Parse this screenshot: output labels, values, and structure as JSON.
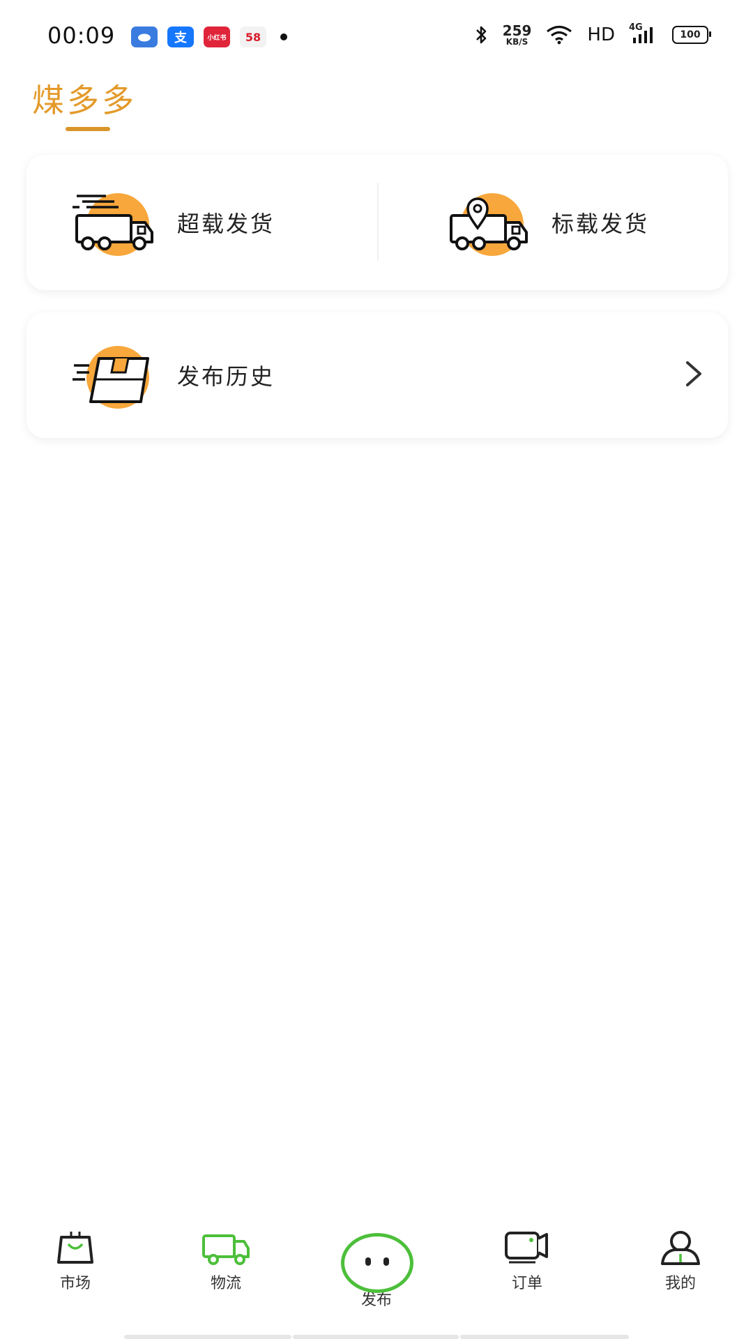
{
  "status_bar": {
    "time": "00:09",
    "apps": [
      {
        "name": "cloud-app",
        "glyph": "",
        "color": "#3A7BE0"
      },
      {
        "name": "alipay-app",
        "glyph": "支",
        "color": "#1677FF"
      },
      {
        "name": "xiaohongshu-app",
        "glyph": "小红书",
        "color": "#E0243A"
      },
      {
        "name": "58-app",
        "glyph": "58",
        "color": "#F2F2F2"
      }
    ],
    "speed_value": "259",
    "speed_unit": "KB/S",
    "network": "HD",
    "signal": "4G",
    "battery": "100"
  },
  "header": {
    "title": "煤多多",
    "accent_color": "#E39A2A"
  },
  "actions": {
    "overload": {
      "label": "超载发货",
      "icon": "speed-truck-icon"
    },
    "standard": {
      "label": "标载发货",
      "icon": "location-truck-icon"
    }
  },
  "history": {
    "label": "发布历史",
    "icon": "fast-box-icon"
  },
  "bottom_nav": {
    "items": [
      {
        "label": "市场",
        "icon": "shopping-bag-icon"
      },
      {
        "label": "物流",
        "icon": "truck-icon",
        "active": true
      },
      {
        "label": "发布",
        "icon": "face-circle-icon"
      },
      {
        "label": "订单",
        "icon": "order-icon"
      },
      {
        "label": "我的",
        "icon": "person-icon"
      }
    ],
    "active_color": "#4CBF3A"
  }
}
